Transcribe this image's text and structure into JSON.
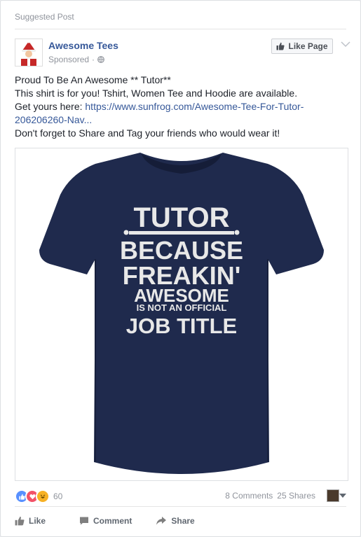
{
  "post": {
    "suggested_label": "Suggested Post",
    "page_name": "Awesome Tees",
    "sponsored_label": "Sponsored",
    "sponsored_sep": "·",
    "like_page_label": "Like Page",
    "text_lines": [
      "Proud To Be An Awesome ** Tutor**",
      "This shirt is for you! Tshirt, Women Tee and Hoodie are available."
    ],
    "link_prefix": "Get yours here: ",
    "link_text_1": "https://www.sunfrog.com/Awesome-Tee-For-Tutor-",
    "link_text_2": "206206260-Nav...",
    "closing_line": "Don't forget to Share and Tag your friends who would wear it!",
    "shirt_lines": [
      "TUTOR",
      "BECAUSE",
      "FREAKIN'",
      "AWESOME",
      "IS NOT AN OFFICIAL",
      "JOB TITLE"
    ]
  },
  "stats": {
    "reaction_count": "60",
    "comments": "8 Comments",
    "shares": "25 Shares"
  },
  "actions": {
    "like": "Like",
    "comment": "Comment",
    "share": "Share"
  },
  "colors": {
    "link": "#365899",
    "shirt": "#1f2a4d",
    "like_reaction": "#5890ff",
    "love_reaction": "#f25268",
    "haha_reaction": "#f7b125"
  }
}
